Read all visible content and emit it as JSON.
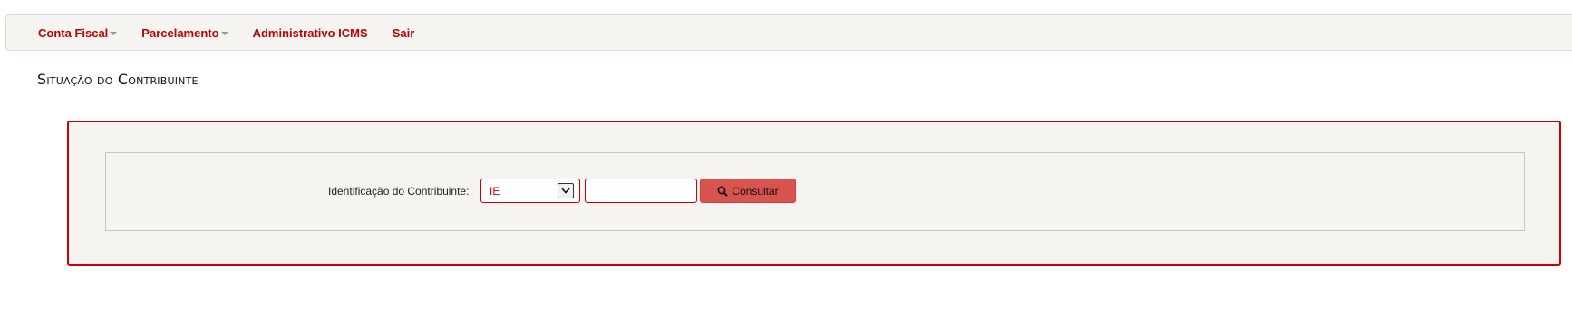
{
  "navbar": {
    "items": [
      {
        "label": "Conta Fiscal",
        "dropdown": true
      },
      {
        "label": "Parcelamento",
        "dropdown": true
      },
      {
        "label": "Administrativo ICMS",
        "dropdown": false
      },
      {
        "label": "Sair",
        "dropdown": false
      }
    ]
  },
  "page": {
    "title": "Situação do Contribuinte"
  },
  "form": {
    "label": "Identificação do Contribuinte:",
    "select_value": "IE",
    "input_value": "",
    "button_label": "Consultar",
    "button_icon": "search-icon"
  },
  "colors": {
    "accent": "#cc0000",
    "button_bg": "#d9534f",
    "panel_bg": "#f5f4f1"
  }
}
